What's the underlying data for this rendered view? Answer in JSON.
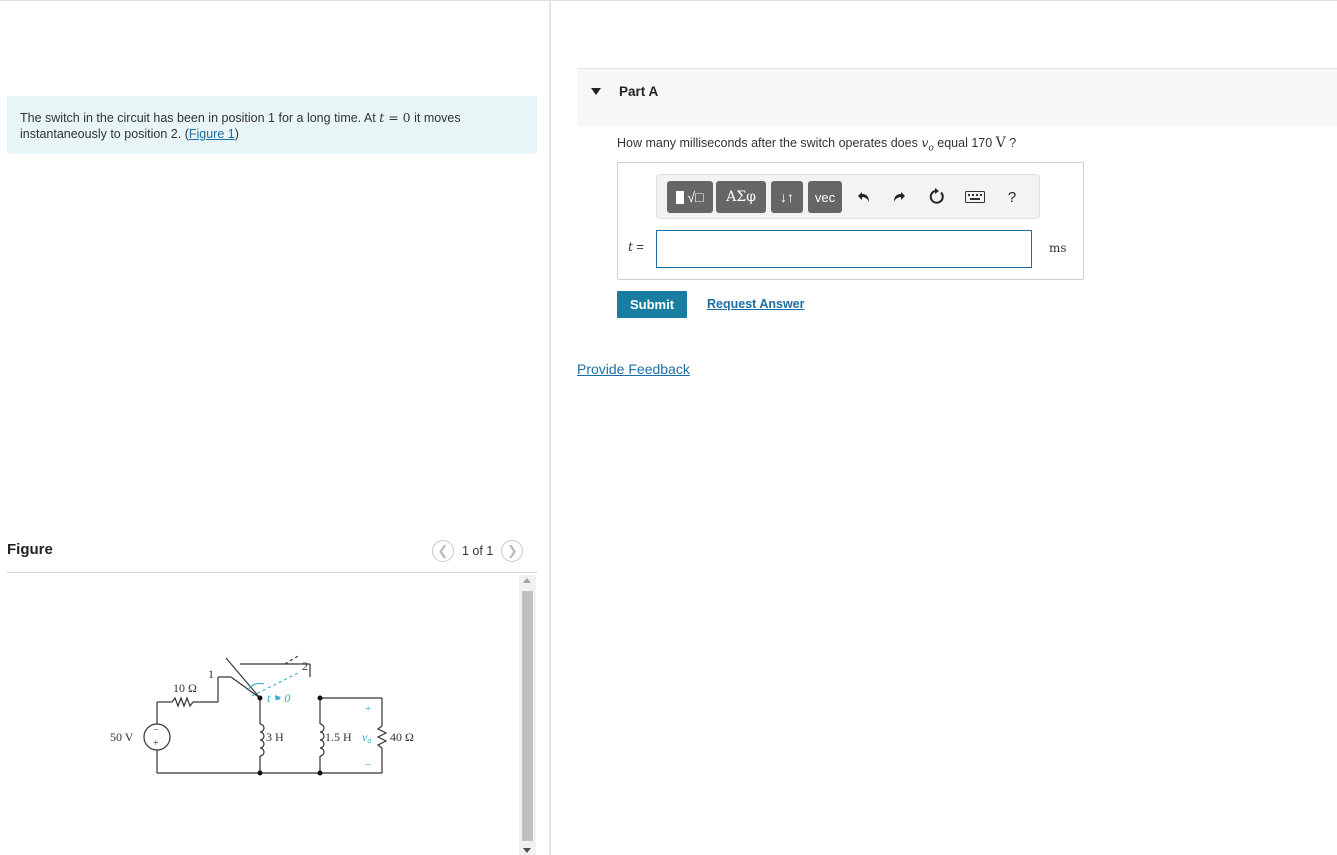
{
  "problem": {
    "text_before": "The switch in the circuit has been in position 1 for a long time. At ",
    "math_t": "t",
    "math_eq": " = 0",
    "text_after": " it moves instantaneously to position 2. (",
    "figure_link": "Figure 1",
    "close_paren": ")"
  },
  "figure": {
    "title": "Figure",
    "pager": "1 of 1",
    "prev_icon": "chevron-left-icon",
    "next_icon": "chevron-right-icon",
    "circuit": {
      "source": "50 V",
      "resistor1": "10 Ω",
      "pos1": "1",
      "pos2": "2",
      "switch_time": "t = 0",
      "inductor1": "3 H",
      "inductor2": "1.5 H",
      "vo": "v",
      "vo_sub": "o",
      "resistor2": "40 Ω",
      "plus": "+",
      "minus": "−"
    }
  },
  "part": {
    "title": "Part A",
    "question_before": "How many milliseconds after the switch operates does ",
    "question_var": "v",
    "question_sub": "o",
    "question_mid": " equal 170 ",
    "question_unit": "V",
    "question_end": " ?",
    "toolbar": {
      "templates_label": "√□",
      "greek_label": "ΑΣφ",
      "arrows_label": "↓↑",
      "vec_label": "vec",
      "undo_icon": "undo-icon",
      "redo_icon": "redo-icon",
      "reset_icon": "reset-icon",
      "keyboard_icon": "keyboard-icon",
      "help_label": "?"
    },
    "answer_label": "t",
    "answer_eq": " =",
    "answer_value": "",
    "unit": "ms",
    "submit_label": "Submit",
    "request_label": "Request Answer"
  },
  "feedback_label": "Provide Feedback",
  "colors": {
    "accent": "#1a7ea2",
    "link": "#1c6ea4",
    "problem_bg": "#e8f5f6",
    "circuit_accent": "#27a9c7"
  }
}
